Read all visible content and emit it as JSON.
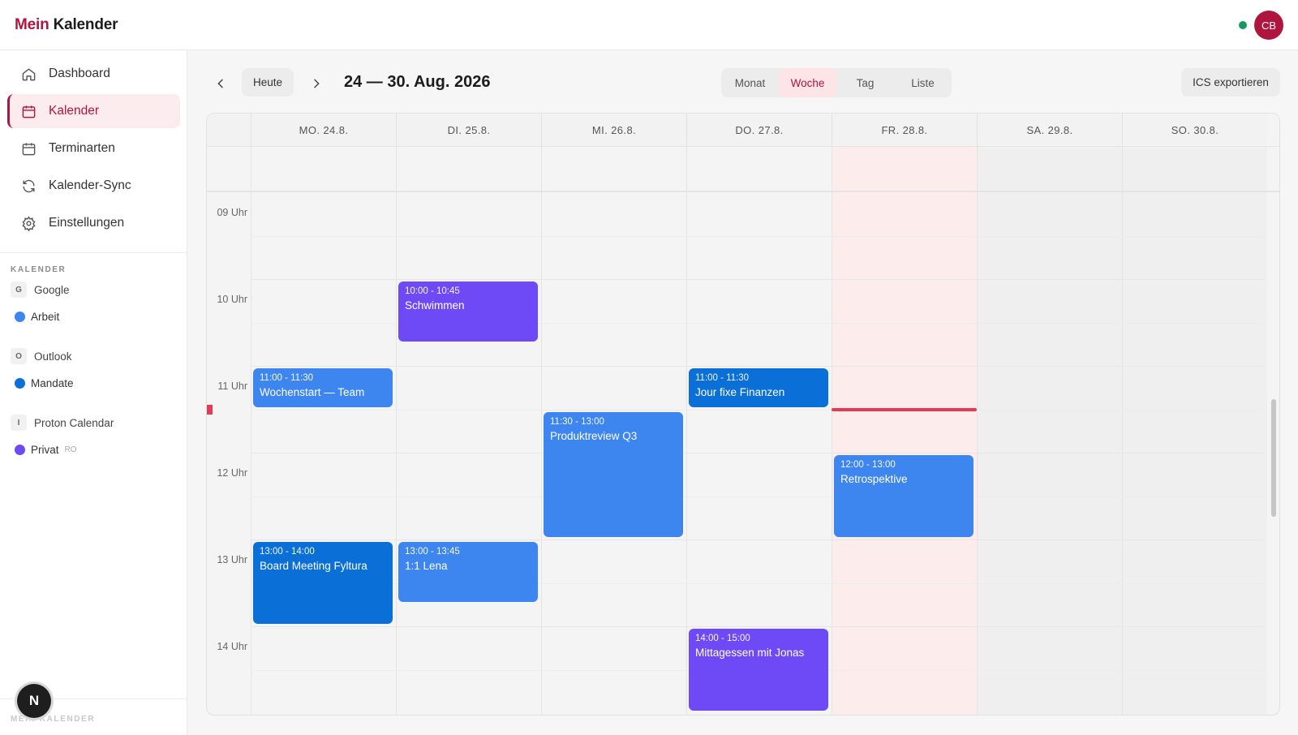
{
  "header": {
    "brand_accent": "Mein",
    "brand_main": "Kalender",
    "avatar_initials": "CB"
  },
  "sidebar": {
    "nav": [
      {
        "label": "Dashboard",
        "icon": "home-icon"
      },
      {
        "label": "Kalender",
        "icon": "calendar-icon",
        "active": true
      },
      {
        "label": "Terminarten",
        "icon": "calendar-outline-icon"
      },
      {
        "label": "Kalender-Sync",
        "icon": "sync-icon"
      },
      {
        "label": "Einstellungen",
        "icon": "gear-icon"
      }
    ],
    "section_title": "KALENDER",
    "accounts": [
      {
        "badge": "G",
        "label": "Google",
        "calendars": [
          {
            "label": "Arbeit",
            "color": "#3d86f0",
            "ro": ""
          }
        ]
      },
      {
        "badge": "O",
        "label": "Outlook",
        "calendars": [
          {
            "label": "Mandate",
            "color": "#0a6fd6",
            "ro": ""
          }
        ]
      },
      {
        "badge": "I",
        "label": "Proton Calendar",
        "calendars": [
          {
            "label": "Privat",
            "color": "#6d4af5",
            "ro": "RO"
          }
        ]
      }
    ],
    "footer": "MEIN KALENDER",
    "fab_label": "N"
  },
  "toolbar": {
    "today_label": "Heute",
    "range_title": "24 — 30. Aug. 2026",
    "views": [
      "Monat",
      "Woche",
      "Tag",
      "Liste"
    ],
    "active_view": "Woche",
    "export_label": "ICS exportieren"
  },
  "calendar": {
    "days": [
      "MO. 24.8.",
      "DI. 25.8.",
      "MI. 26.8.",
      "DO. 27.8.",
      "FR. 28.8.",
      "SA. 29.8.",
      "SO. 30.8."
    ],
    "today_index": 4,
    "weekend_indices": [
      5,
      6
    ],
    "hours": [
      "09 Uhr",
      "10 Uhr",
      "11 Uhr",
      "12 Uhr",
      "13 Uhr",
      "14 Uhr"
    ],
    "now_time": "11:30",
    "events": [
      {
        "day": 1,
        "start": "10:00",
        "end": "10:45",
        "time": "10:00 - 10:45",
        "title": "Schwimmen",
        "color": "purple"
      },
      {
        "day": 0,
        "start": "11:00",
        "end": "11:30",
        "time": "11:00 - 11:30",
        "title": "Wochenstart — Team",
        "color": "blue"
      },
      {
        "day": 3,
        "start": "11:00",
        "end": "11:30",
        "time": "11:00 - 11:30",
        "title": "Jour fixe Finanzen",
        "color": "deep"
      },
      {
        "day": 2,
        "start": "11:30",
        "end": "13:00",
        "time": "11:30 - 13:00",
        "title": "Produktreview Q3",
        "color": "blue"
      },
      {
        "day": 4,
        "start": "12:00",
        "end": "13:00",
        "time": "12:00 - 13:00",
        "title": "Retrospektive",
        "color": "blue"
      },
      {
        "day": 0,
        "start": "13:00",
        "end": "14:00",
        "time": "13:00 - 14:00",
        "title": "Board Meeting Fyltura",
        "color": "deep"
      },
      {
        "day": 1,
        "start": "13:00",
        "end": "13:45",
        "time": "13:00 - 13:45",
        "title": "1:1 Lena",
        "color": "blue"
      },
      {
        "day": 3,
        "start": "14:00",
        "end": "15:00",
        "time": "14:00 - 15:00",
        "title": "Mittagessen mit Jonas",
        "color": "purple"
      }
    ]
  }
}
